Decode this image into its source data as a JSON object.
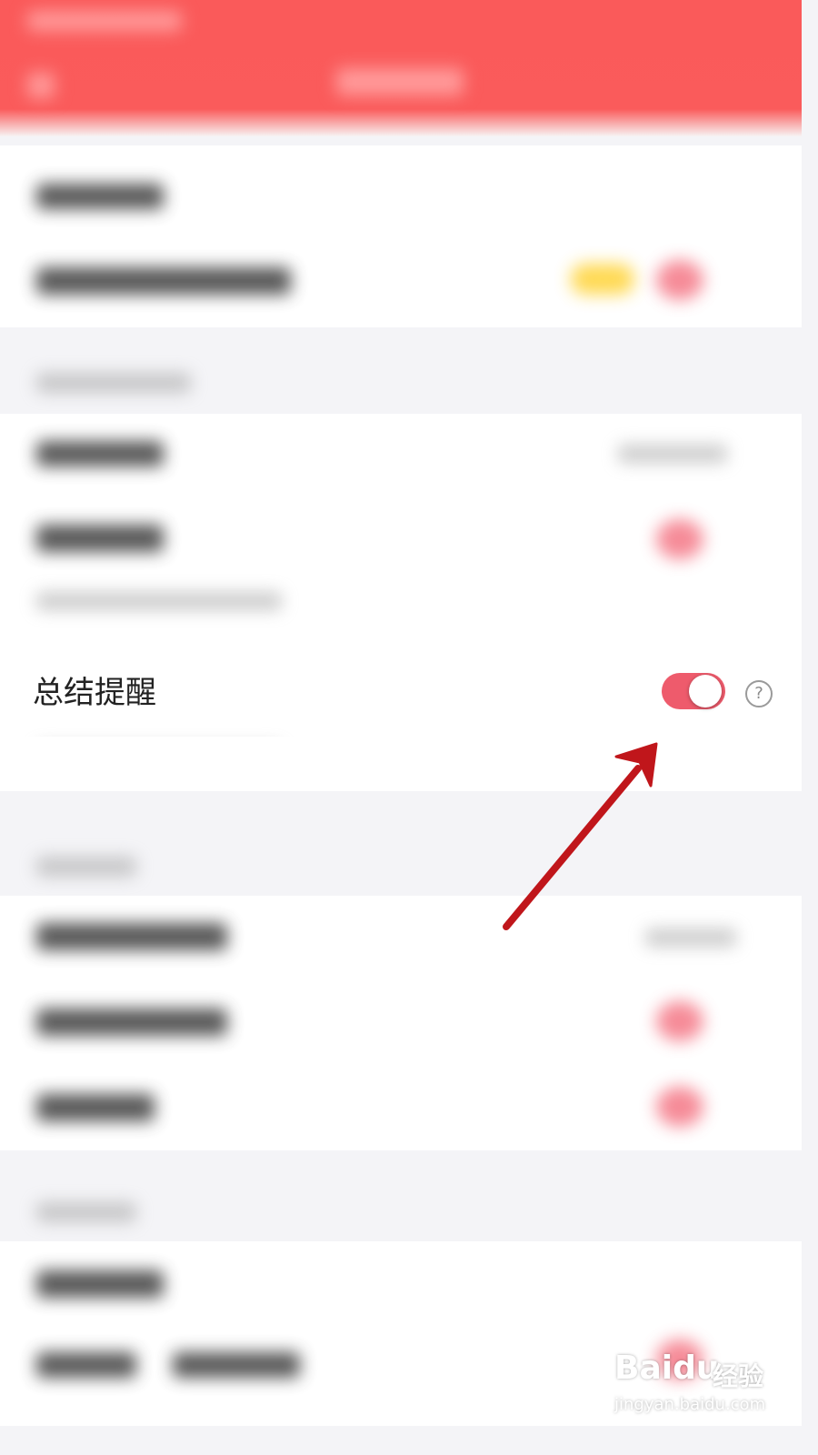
{
  "setting": {
    "label": "总结提醒",
    "enabled": true,
    "help_symbol": "?"
  },
  "colors": {
    "header": "#fa5a5a",
    "toggle_on": "#ee5b6c",
    "arrow": "#c0161b",
    "background": "#f4f4f7"
  },
  "icons": {
    "help": "question-circle-icon",
    "annotation": "red-arrow-annotation"
  },
  "watermark": {
    "logo": "Baidu",
    "product": "经验",
    "url": "jingyan.baidu.com"
  }
}
